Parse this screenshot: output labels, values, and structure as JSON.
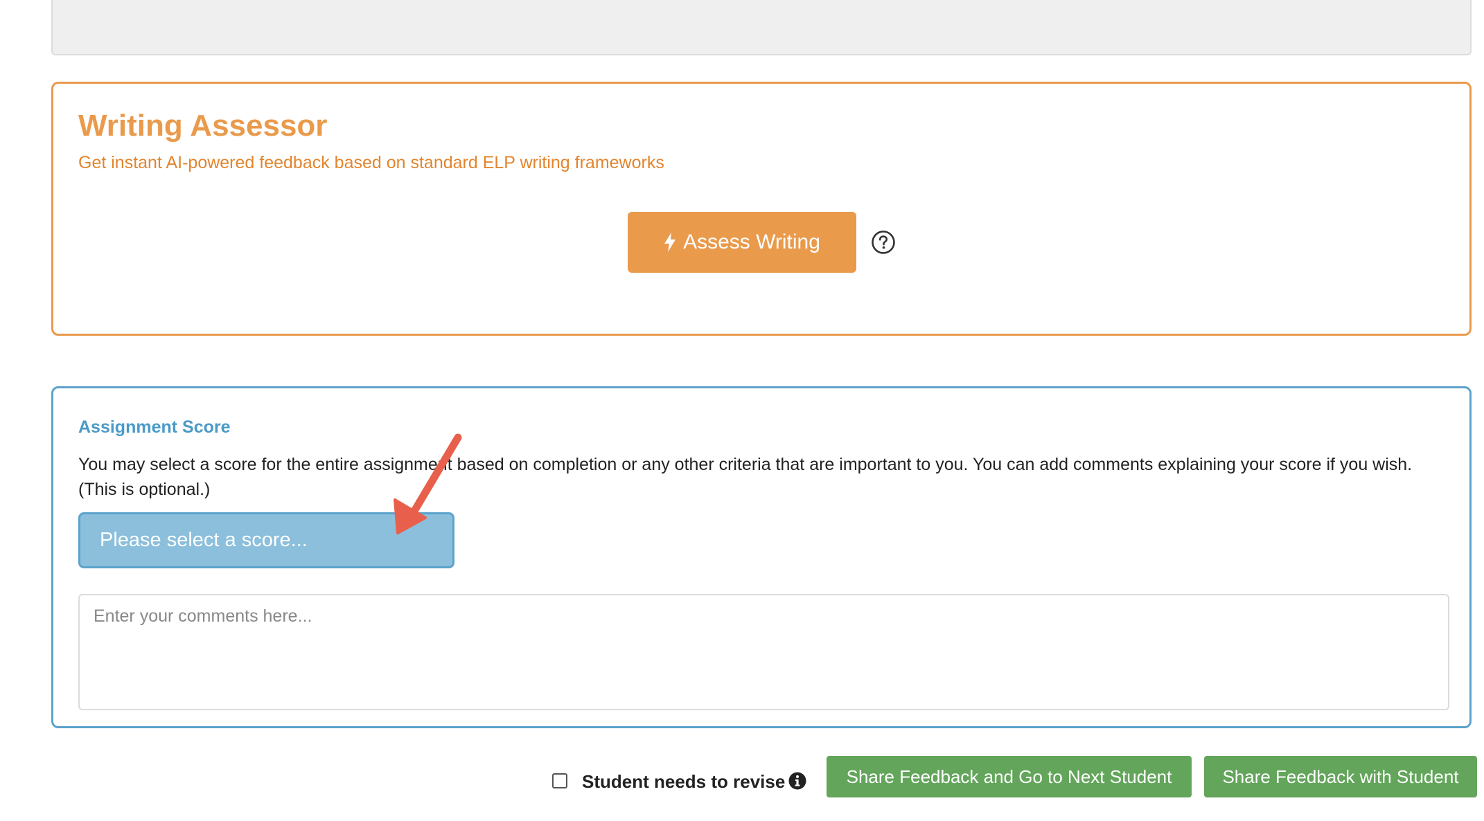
{
  "assessor": {
    "title": "Writing Assessor",
    "subtitle": "Get instant AI-powered feedback based on standard ELP writing frameworks",
    "button_label": "Assess Writing",
    "button_icon": "lightning-bolt-icon",
    "help_icon": "question-circle-icon",
    "accent_color": "#e99a4b"
  },
  "assignment_score": {
    "title": "Assignment Score",
    "description": "You may select a score for the entire assignment based on completion or any other criteria that are important to you. You can add comments explaining your score if you wish. (This is optional.)",
    "select_value": "Please select a score...",
    "comments_placeholder": "Enter your comments here...",
    "accent_color": "#5ba3cc"
  },
  "footer": {
    "revise_label": "Student needs to revise",
    "revise_checked": false,
    "info_icon": "info-circle-icon",
    "next_button_label": "Share Feedback and Go to Next Student",
    "share_button_label": "Share Feedback with Student",
    "button_color": "#63a55b"
  }
}
